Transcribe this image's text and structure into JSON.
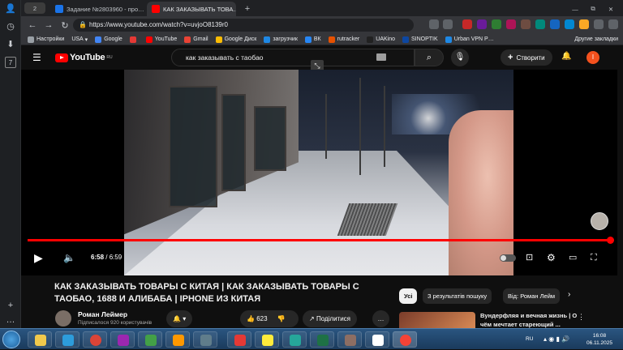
{
  "browser": {
    "tab_count": "2",
    "tabs": [
      {
        "label": "Задание №2803960 - про…",
        "color": "#1a73e8"
      },
      {
        "label": "КАК ЗАКАЗЫВАТЬ ТОВА…",
        "color": "#ff0000"
      }
    ],
    "url": "https://www.youtube.com/watch?v=uvjoO8139r0",
    "bookmarks": [
      "Настройки",
      "USA",
      "Google",
      "",
      "YouTube",
      "Gmail",
      "Google Диск",
      "загрузчик",
      "ВК",
      "rutracker",
      "UAKino",
      "",
      "SINOPTIK",
      "",
      "Urban VPN P…"
    ],
    "other_bookmarks": "Другие закладки"
  },
  "youtube": {
    "logo_text": "YouTube",
    "region": "RU",
    "search_query": "как заказывать с таобао",
    "create_label": "Створити",
    "avatar_letter": "І"
  },
  "player": {
    "time_current": "6:58",
    "time_total": "6:59",
    "progress_fraction": 0.998
  },
  "video": {
    "title": "КАК ЗАКАЗЫВАТЬ ТОВАРЫ С КИТАЯ | КАК ЗАКАЗЫВАТЬ ТОВАРЫ С ТАОБАО, 1688 И АЛИБАБА | IPHONE ИЗ КИТАЯ",
    "channel": "Роман Леймер",
    "subscribers": "Підписалося 920 користувачів",
    "likes": "623",
    "share_label": "Поділитися"
  },
  "chips": [
    "Усі",
    "З результатів пошуку",
    "Від: Роман Лейм"
  ],
  "recommended": {
    "title": "Вундерфляя и вечная жизнь | О чём мечтает стареющий ..."
  },
  "taskbar": {
    "lang": "RU",
    "time": "16:08",
    "date": "06.11.2025"
  }
}
